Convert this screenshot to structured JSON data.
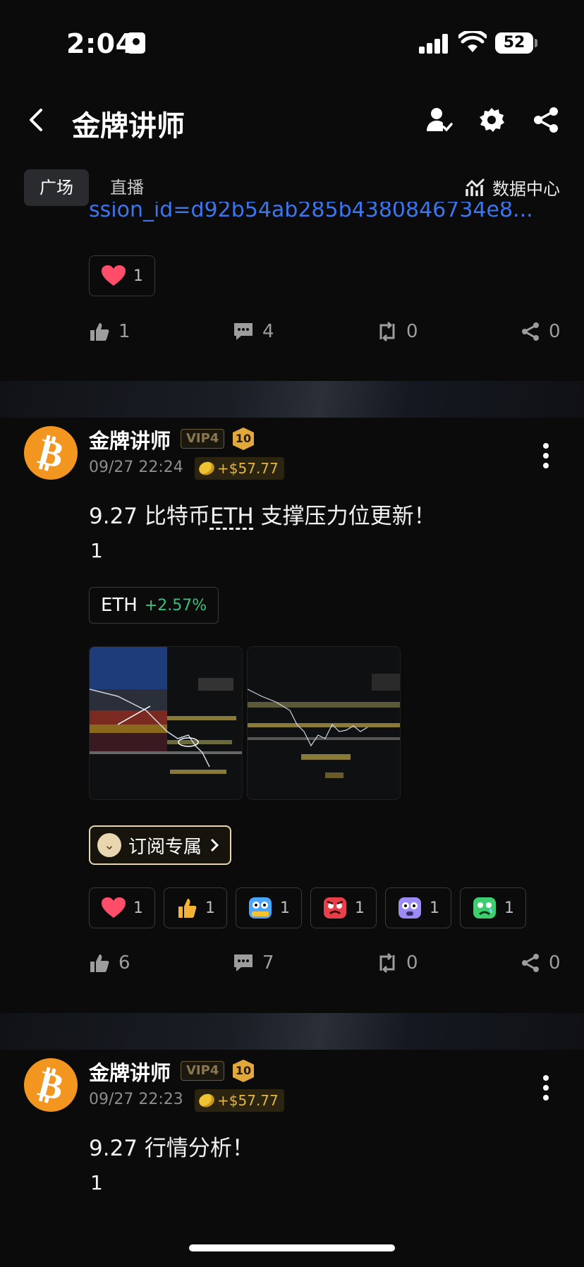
{
  "status": {
    "time": "2:04",
    "battery": "52"
  },
  "header": {
    "title": "金牌讲师"
  },
  "tabs": [
    {
      "label": "广场"
    },
    {
      "label": "直播"
    }
  ],
  "data_center": "数据中心",
  "partial_post": {
    "link_text": "ssion_id=d92b54ab285b4380846734e8...",
    "heart_count": "1",
    "likes": "1",
    "comments": "4",
    "reposts": "0",
    "shares": "0"
  },
  "posts": [
    {
      "author": "金牌讲师",
      "vip": "VIP4",
      "level": "10",
      "time": "09/27 22:24",
      "earnings": "+$57.77",
      "title_prefix": "9.27 比特币",
      "title_ticker": "ETH",
      "title_suffix": " 支撑压力位更新！",
      "body": "1",
      "ticker": {
        "symbol": "ETH",
        "change": "+2.57%"
      },
      "subscribe_label": "订阅专属",
      "reactions": [
        "1",
        "1",
        "1",
        "1",
        "1",
        "1"
      ],
      "likes": "6",
      "comments": "7",
      "reposts": "0",
      "shares": "0"
    },
    {
      "author": "金牌讲师",
      "vip": "VIP4",
      "level": "10",
      "time": "09/27 22:23",
      "earnings": "+$57.77",
      "title": "9.27 行情分析！",
      "body": "1"
    }
  ],
  "icons": {
    "back": "chevron-left-icon",
    "user": "user-check-icon",
    "settings": "gear-icon",
    "share": "share-icon",
    "data_center": "chart-icon",
    "like": "thumbs-up-icon",
    "comment": "comment-icon",
    "repost": "repost-icon"
  },
  "colors": {
    "link": "#3b76ef",
    "positive": "#35c27b",
    "gold": "#e4b548",
    "bitcoin": "#f2961f"
  }
}
